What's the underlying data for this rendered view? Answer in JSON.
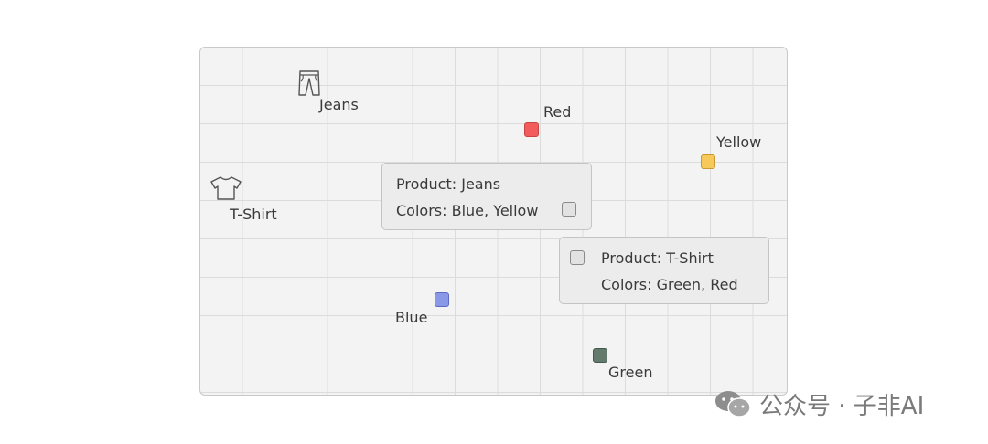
{
  "items": {
    "jeans": {
      "label": "Jeans",
      "icon": "jeans-icon"
    },
    "tshirt": {
      "label": "T-Shirt",
      "icon": "tshirt-icon"
    }
  },
  "colors": {
    "red": {
      "label": "Red",
      "fill": "#f25c5c",
      "stroke": "#c94444"
    },
    "yellow": {
      "label": "Yellow",
      "fill": "#f7c85a",
      "stroke": "#c99a32"
    },
    "blue": {
      "label": "Blue",
      "fill": "#8a98e8",
      "stroke": "#5d6bc2"
    },
    "green": {
      "label": "Green",
      "fill": "#647a6c",
      "stroke": "#44574b"
    }
  },
  "cards": {
    "jeans": {
      "product": "Product: Jeans",
      "colors": "Colors: Blue, Yellow"
    },
    "tshirt": {
      "product": "Product: T-Shirt",
      "colors": "Colors: Green, Red"
    }
  },
  "watermark": {
    "text": "公众号 · 子非AI",
    "icon": "wechat-icon"
  }
}
